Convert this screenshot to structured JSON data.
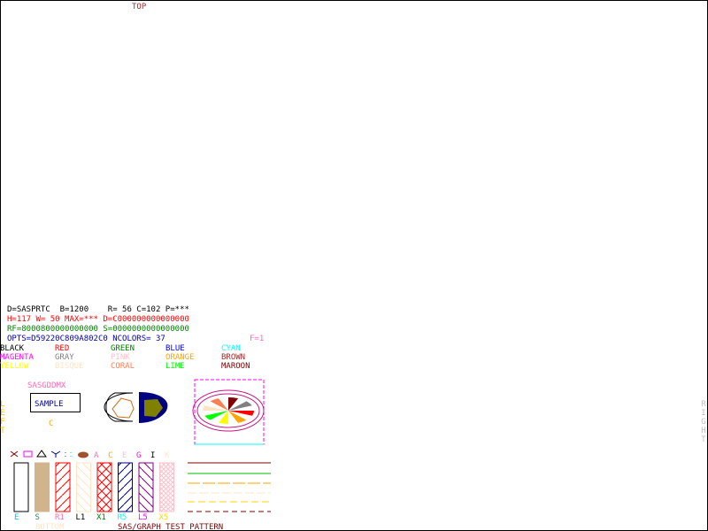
{
  "top_label": "TOP",
  "info": {
    "line1": "D=SASPRTC  B=1200    R= 56 C=102 P=***",
    "line2": "H=117 W= 50 MAX=*** D=C000000000000000",
    "line3": "RF=8000800000000000 S=0000000000000000",
    "line4": "OPTS=D59220C809A802C0 NCOLORS= 37",
    "f_label": "F=1"
  },
  "colors_grid": [
    {
      "name": "BLACK",
      "color": "#000000"
    },
    {
      "name": "RED",
      "color": "#ff0000"
    },
    {
      "name": "GREEN",
      "color": "#008000"
    },
    {
      "name": "BLUE",
      "color": "#0000ff"
    },
    {
      "name": "CYAN",
      "color": "#00ffff"
    },
    {
      "name": "MAGENTA",
      "color": "#ff00ff"
    },
    {
      "name": "GRAY",
      "color": "#808080"
    },
    {
      "name": "PINK",
      "color": "#ffc0cb"
    },
    {
      "name": "ORANGE",
      "color": "#ffa500"
    },
    {
      "name": "BROWN",
      "color": "#a52a2a"
    },
    {
      "name": "YELLOW",
      "color": "#ffff00"
    },
    {
      "name": "BISQUE",
      "color": "#ffe4c4"
    },
    {
      "name": "CORAL",
      "color": "#ff7f50"
    },
    {
      "name": "LIME",
      "color": "#00ff00"
    },
    {
      "name": "MAROON",
      "color": "#800000"
    }
  ],
  "left_label": "LEFT",
  "right_label": "RIGHT",
  "sas_label": "SASGDDMX",
  "sample_label": "SAMPLE",
  "c_label": "C",
  "letters_row": [
    "A",
    "C",
    "E",
    "G",
    "I",
    "K"
  ],
  "patterns": [
    {
      "label": "E",
      "color": "#00bfff"
    },
    {
      "label": "S",
      "color": "#2e8b57"
    },
    {
      "label": "R1",
      "color": "#ff69b4"
    },
    {
      "label": "L1",
      "color": "#000000"
    },
    {
      "label": "X1",
      "color": "#008000"
    },
    {
      "label": "R5",
      "color": "#00ffff"
    },
    {
      "label": "L5",
      "color": "#ff00ff"
    },
    {
      "label": "X5",
      "color": "#ffd700"
    }
  ],
  "bottom_label": "BOTTOM",
  "footer_title": "SAS/GRAPH TEST PATTERN",
  "colors_palette": {
    "pie": [
      "#ff0000",
      "#ffa500",
      "#ffff00",
      "#00ff00",
      "#ffe4c4",
      "#ff7f50",
      "#800000",
      "#808080"
    ]
  }
}
